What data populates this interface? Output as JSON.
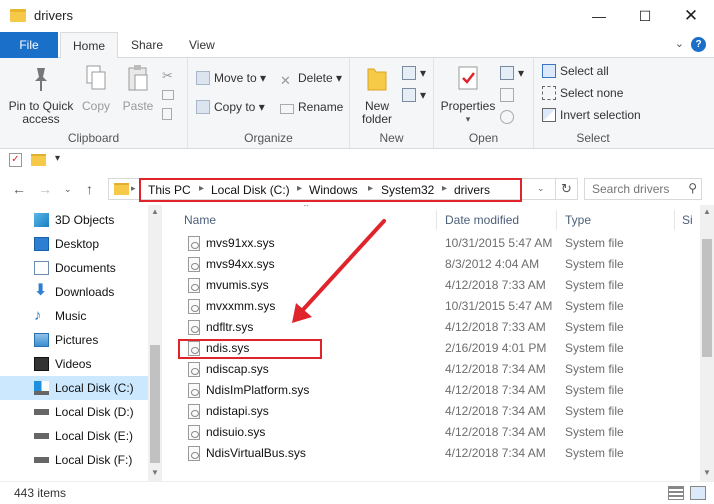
{
  "window": {
    "title": "drivers"
  },
  "tabs": {
    "file": "File",
    "home": "Home",
    "share": "Share",
    "view": "View"
  },
  "ribbon": {
    "clipboard": {
      "label": "Clipboard",
      "pin": "Pin to Quick access",
      "copy": "Copy",
      "paste": "Paste"
    },
    "organize": {
      "label": "Organize",
      "move_to": "Move to",
      "copy_to": "Copy to",
      "delete": "Delete",
      "rename": "Rename"
    },
    "new": {
      "label": "New",
      "new_folder": "New folder"
    },
    "open": {
      "label": "Open",
      "properties": "Properties"
    },
    "select": {
      "label": "Select",
      "select_all": "Select all",
      "select_none": "Select none",
      "invert": "Invert selection"
    }
  },
  "address": {
    "crumbs": [
      "This PC",
      "Local Disk (C:)",
      "Windows",
      "System32",
      "drivers"
    ],
    "search_placeholder": "Search drivers"
  },
  "sidebar": {
    "items": [
      "3D Objects",
      "Desktop",
      "Documents",
      "Downloads",
      "Music",
      "Pictures",
      "Videos",
      "Local Disk (C:)",
      "Local Disk (D:)",
      "Local Disk (E:)",
      "Local Disk (F:)"
    ]
  },
  "columns": {
    "name": "Name",
    "date": "Date modified",
    "type": "Type",
    "size": "Si"
  },
  "files": [
    {
      "name": "mvs91xx.sys",
      "date": "10/31/2015 5:47 AM",
      "type": "System file"
    },
    {
      "name": "mvs94xx.sys",
      "date": "8/3/2012 4:04 AM",
      "type": "System file"
    },
    {
      "name": "mvumis.sys",
      "date": "4/12/2018 7:33 AM",
      "type": "System file"
    },
    {
      "name": "mvxxmm.sys",
      "date": "10/31/2015 5:47 AM",
      "type": "System file"
    },
    {
      "name": "ndfltr.sys",
      "date": "4/12/2018 7:33 AM",
      "type": "System file"
    },
    {
      "name": "ndis.sys",
      "date": "2/16/2019 4:01 PM",
      "type": "System file"
    },
    {
      "name": "ndiscap.sys",
      "date": "4/12/2018 7:34 AM",
      "type": "System file"
    },
    {
      "name": "NdisImPlatform.sys",
      "date": "4/12/2018 7:34 AM",
      "type": "System file"
    },
    {
      "name": "ndistapi.sys",
      "date": "4/12/2018 7:34 AM",
      "type": "System file"
    },
    {
      "name": "ndisuio.sys",
      "date": "4/12/2018 7:34 AM",
      "type": "System file"
    },
    {
      "name": "NdisVirtualBus.sys",
      "date": "4/12/2018 7:34 AM",
      "type": "System file"
    }
  ],
  "status": {
    "count": "443 items"
  },
  "colors": {
    "accent": "#1a6fc8",
    "highlight": "#e0242c",
    "selected": "#cce8ff"
  }
}
